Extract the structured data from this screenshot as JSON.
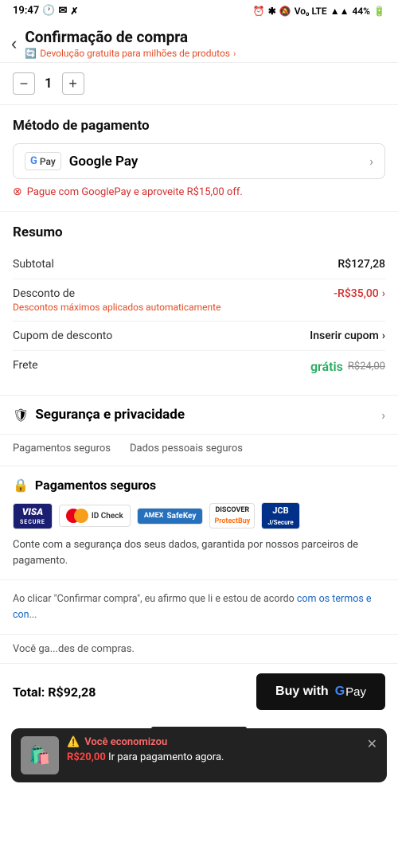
{
  "statusBar": {
    "time": "19:47",
    "battery": "44%"
  },
  "header": {
    "title": "Confirmação de compra",
    "freeReturn": "Devolução gratuita para milhões de produtos",
    "backLabel": "‹"
  },
  "quantity": {
    "value": "1",
    "decreaseLabel": "−",
    "increaseLabel": "+"
  },
  "paymentMethod": {
    "sectionTitle": "Método de pagamento",
    "name": "Google Pay",
    "promoText": "Pague com GooglePay e aproveite R$15,00 off."
  },
  "summary": {
    "sectionTitle": "Resumo",
    "subtotalLabel": "Subtotal",
    "subtotalValue": "R$127,28",
    "discountLabel": "Desconto de",
    "discountSub": "Descontos máximos aplicados automaticamente",
    "discountValue": "-R$35,00",
    "couponLabel": "Cupom de desconto",
    "couponValue": "Inserir cupom",
    "shippingLabel": "Frete",
    "shippingFree": "grátis",
    "shippingOriginal": "R$24,00"
  },
  "security": {
    "headerTitle": "Segurança e privacidade",
    "subItems": [
      "Pagamentos seguros",
      "Dados pessoais seguros"
    ],
    "badgesTitle": "Pagamentos seguros",
    "badges": [
      {
        "id": "visa",
        "label": "VISA",
        "sub": "SECURE"
      },
      {
        "id": "mastercard",
        "label": "ID Check"
      },
      {
        "id": "amex",
        "label": "SafeKey"
      },
      {
        "id": "discover",
        "label": "ProtectBuy"
      },
      {
        "id": "jcb",
        "label": "J/Secure"
      }
    ],
    "description": "Conte com a segurança dos seus dados, garantida por nossos parceiros de pagamento."
  },
  "agreement": {
    "text1": "Ao clicar \"Confirmar compra\", eu afirmo que li e estou de acordo ",
    "linkText": "com os termos e con",
    "linkEllipsis": "..."
  },
  "youSave": {
    "prefix": "Você ga",
    "suffix": "des de compras."
  },
  "toast": {
    "icon": "🛍️",
    "titleIcon": "⚠️",
    "title": "Você economizou",
    "amount": "R$20,00",
    "body": "Ir para pagamento agora.",
    "closeLabel": "✕"
  },
  "bottomBar": {
    "totalLabel": "Total:",
    "totalValue": "R$92,28",
    "buyLabel": "Buy with",
    "payLabel": "Pay"
  }
}
